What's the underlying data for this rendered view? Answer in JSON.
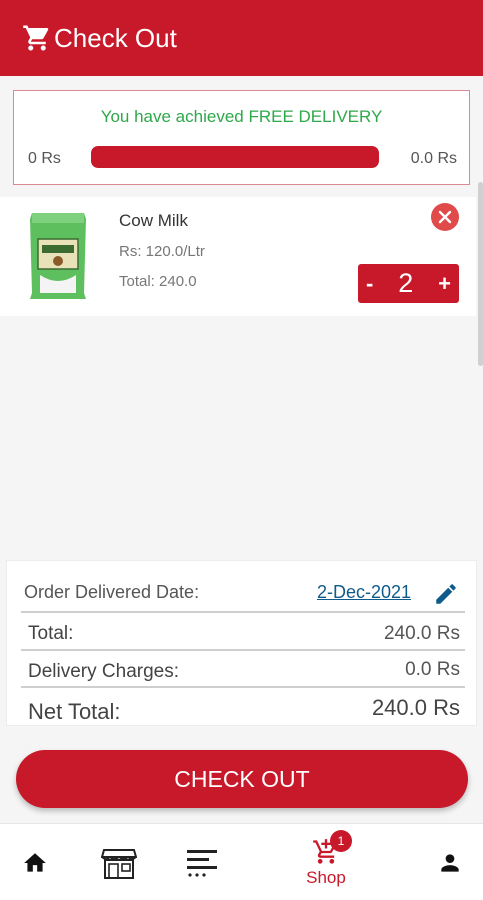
{
  "header": {
    "title": "Check Out",
    "icon": "cart-icon"
  },
  "delivery": {
    "message": "You have achieved FREE DELIVERY",
    "min_label": "0 Rs",
    "max_label": "0.0 Rs",
    "progress_fraction": 1.0
  },
  "cart_item": {
    "name": "Cow Milk",
    "price": "Rs: 120.0/Ltr",
    "total": "Total: 240.0",
    "quantity": "2",
    "minus_label": "-",
    "plus_label": "+"
  },
  "summary": {
    "order_date_label": "Order Delivered Date:",
    "order_date_value": "2-Dec-2021",
    "total_label": "Total:",
    "total_value": "240.0 Rs",
    "delivery_label": "Delivery Charges:",
    "delivery_value": "0.0 Rs",
    "net_label": "Net Total:",
    "net_value": "240.0 Rs"
  },
  "checkout_button": {
    "label": "CHECK OUT"
  },
  "bottom_nav": {
    "items": [
      {
        "icon": "home-icon"
      },
      {
        "icon": "store-icon"
      },
      {
        "icon": "menu-list-icon"
      },
      {
        "icon": "cart-add-icon",
        "label": "Shop",
        "badge": "1"
      },
      {
        "icon": "profile-icon"
      }
    ]
  },
  "colors": {
    "primary": "#c8192b",
    "success": "#2ea84a",
    "link": "#0e5b8b",
    "remove": "#e04a4a"
  }
}
